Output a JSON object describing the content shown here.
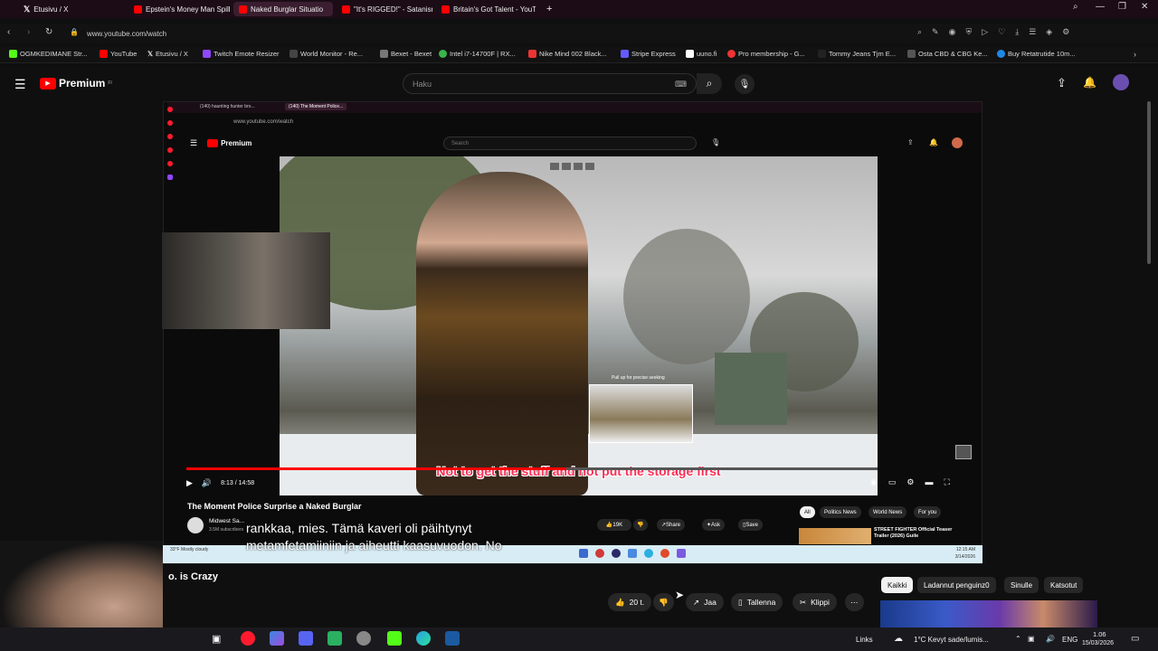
{
  "browser": {
    "tabs": [
      {
        "label": "Etusivu / X",
        "active": false
      },
      {
        "label": "Epstein's Money Man Spill",
        "active": false
      },
      {
        "label": "Naked Burglar Situatio",
        "active": true
      },
      {
        "label": "\"It's RIGGED!\" - Satanism,",
        "active": false
      },
      {
        "label": "Britain's Got Talent - YouT",
        "active": false
      }
    ],
    "new_tab": "+",
    "url": "www.youtube.com/watch",
    "bookmarks": [
      "OGMKEDIMANE Str...",
      "YouTube",
      "Etusivu / X",
      "Twitch Emote Resizer",
      "World Monitor - Re...",
      "Bexet - Bexet",
      "Intel i7-14700F | RX...",
      "Nike Mind 002 Black...",
      "Stripe Express",
      "uuno.fi",
      "Pro membership - G...",
      "Tommy Jeans Tjm E...",
      "Ostа CBD & CBG Ke...",
      "Buy Retatrutide 10m..."
    ]
  },
  "youtube": {
    "logo": "Premium",
    "logo_sup": "FI",
    "search_placeholder": "Haku"
  },
  "stream": {
    "inner_tabs": [
      "(140) haunting hunter bro...",
      "(140) The Moment Police..."
    ],
    "inner_url": "www.youtube.com/watch",
    "inner_logo": "Premium",
    "inner_search": "Search",
    "caption": "Not to get the stuff and not put the storage first",
    "time": "8:13 / 14:58",
    "progress": 0.55,
    "popup_text": "Pull up for precise seeking",
    "title": "The Moment Police Surprise a Naked Burglar",
    "channel": "Midwest Sa...",
    "subs": "3.5M subscribers",
    "likes": "19K",
    "share": "Share",
    "ask": "Ask",
    "save": "Save",
    "chips": [
      "All",
      "Politics News",
      "World News",
      "For you"
    ],
    "rec_title": "STREET FIGHTER Official Teaser Trailer (2026) Guile",
    "subtitle_line1": "rankkaa, mies.  Tämä kaveri oli päihtynyt",
    "subtitle_line2": "metamfetamiiniin ja aiheutti kaasuvuodon.  No",
    "weather": "33°F Mostly cloudy",
    "inner_clock": "12:15 AM",
    "inner_date": "3/14/2026"
  },
  "outer": {
    "title_fragment": "o. is Crazy",
    "likes": "20 t.",
    "share": "Jaa",
    "save": "Tallenna",
    "clip": "Klippi",
    "chips": [
      "Kaikki",
      "Ladannut penguinz0",
      "Sinulle",
      "Katsotut"
    ]
  },
  "taskbar": {
    "links": "Links",
    "weather": "1°C  Kevyt sade/lumis...",
    "lang": "ENG",
    "time": "1.06",
    "date": "15/03/2026"
  },
  "colors": {
    "yt_red": "#ff0000",
    "caption_red": "#ff2d55",
    "opera_red": "#ff1b2d"
  }
}
